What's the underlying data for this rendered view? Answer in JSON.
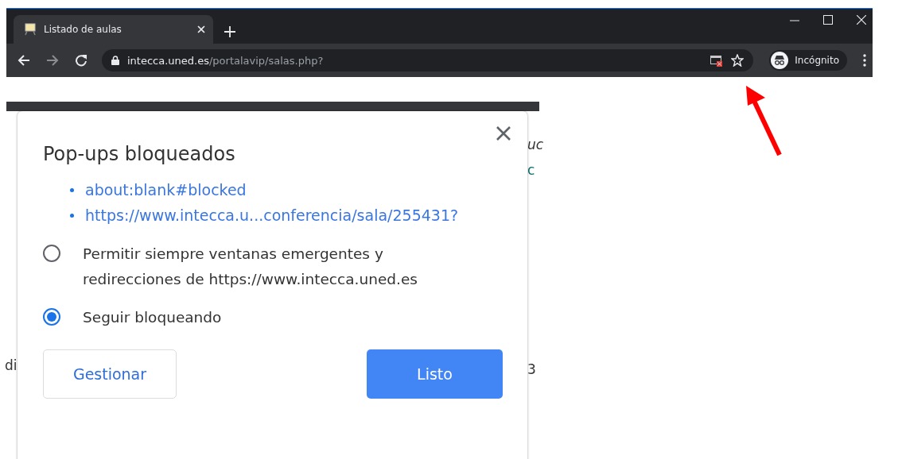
{
  "browser": {
    "tab": {
      "title": "Listado de aulas",
      "selected": true
    },
    "address": {
      "host": "intecca.uned.es",
      "path": "/portalavip/salas.php?"
    },
    "popup_blocked": true,
    "profile": "Incógnito"
  },
  "page_fragments": [
    "uc",
    "c",
    "di",
    "3"
  ],
  "dialog": {
    "title": "Pop-ups bloqueados",
    "links": [
      "about:blank#blocked",
      "https://www.intecca.u...conferencia/sala/255431?"
    ],
    "options": [
      {
        "label": "Permitir siempre ventanas emergentes y redirecciones de https://www.intecca.uned.es",
        "selected": false
      },
      {
        "label": "Seguir bloqueando",
        "selected": true
      }
    ],
    "buttons": [
      {
        "label": "Gestionar",
        "kind": "secondary"
      },
      {
        "label": "Listo",
        "kind": "primary"
      }
    ]
  }
}
